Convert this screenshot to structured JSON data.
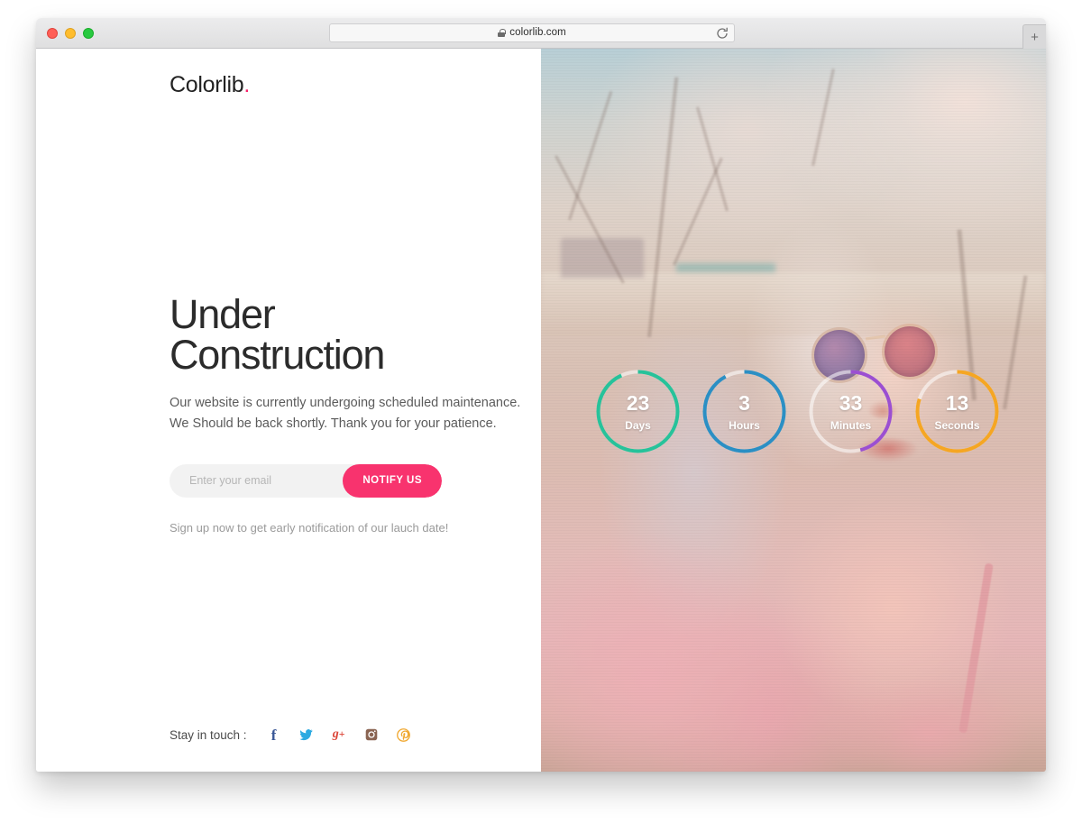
{
  "browser": {
    "url": "colorlib.com",
    "lock_icon": "lock-icon",
    "reload_icon": "reload-icon",
    "newtab_label": "+",
    "traffic_lights": [
      "close",
      "minimize",
      "maximize"
    ]
  },
  "site": {
    "logo_text": "Colorlib",
    "logo_dot": ".",
    "headline": "Under\nConstruction",
    "subtext": "Our website is currently undergoing scheduled maintenance. We Should be back shortly. Thank you for your patience.",
    "signup_note": "Sign up now to get early notification of our lauch date!"
  },
  "form": {
    "email_placeholder": "Enter your email",
    "email_value": "",
    "notify_label": "NOTIFY US"
  },
  "social": {
    "label": "Stay in touch :",
    "items": [
      {
        "name": "facebook",
        "glyph": "f",
        "color": "#3b5998"
      },
      {
        "name": "twitter",
        "glyph": "twitter-bird",
        "color": "#2daae1"
      },
      {
        "name": "google-plus",
        "glyph": "g+",
        "color": "#db4437"
      },
      {
        "name": "instagram",
        "glyph": "camera",
        "color": "#8a6452"
      },
      {
        "name": "pinterest",
        "glyph": "p",
        "color": "#f0a830"
      }
    ]
  },
  "countdown": {
    "units": [
      {
        "value": "23",
        "label": "Days",
        "color": "#27c29a",
        "percent": 93
      },
      {
        "value": "3",
        "label": "Hours",
        "color": "#2b8fc4",
        "percent": 92
      },
      {
        "value": "33",
        "label": "Minutes",
        "color": "#9b4fd1",
        "percent": 46
      },
      {
        "value": "13",
        "label": "Seconds",
        "color": "#f5a623",
        "percent": 80
      }
    ]
  },
  "colors": {
    "accent_pink": "#f8336e",
    "headline": "#2b2b2b",
    "body_text": "#5b5b5b"
  }
}
